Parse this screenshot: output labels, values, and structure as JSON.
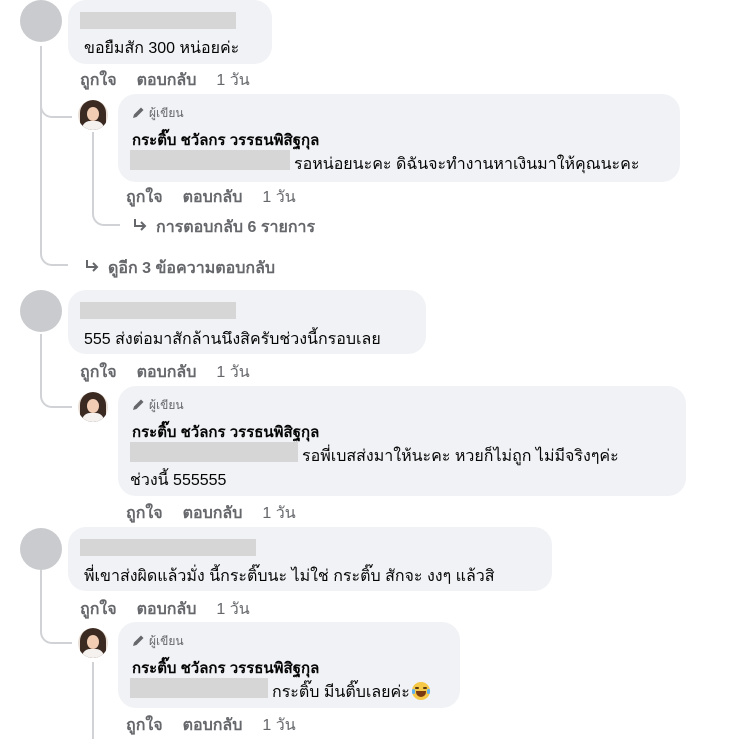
{
  "threads": [
    {
      "comment": {
        "text": "ขอยืมสัก 300 หน่อยค่ะ"
      },
      "actions": {
        "like": "ถูกใจ",
        "reply": "ตอบกลับ",
        "time": "1 วัน"
      },
      "reply": {
        "badge": "ผู้เขียน",
        "author": "กระติ๊บ ชวัลกร วรรธนพิสิฐกุล",
        "text": "รอหน่อยนะคะ ดิฉันจะทำงานหาเงินมาให้คุณนะคะ",
        "actions": {
          "like": "ถูกใจ",
          "reply": "ตอบกลับ",
          "time": "1 วัน"
        },
        "more_replies": "การตอบกลับ 6 รายการ"
      },
      "view_more": "ดูอีก 3 ข้อความตอบกลับ"
    },
    {
      "comment": {
        "text": "555 ส่งต่อมาสักล้านนึงสิครับช่วงนี้กรอบเลย"
      },
      "actions": {
        "like": "ถูกใจ",
        "reply": "ตอบกลับ",
        "time": "1 วัน"
      },
      "reply": {
        "badge": "ผู้เขียน",
        "author": "กระติ๊บ ชวัลกร วรรธนพิสิฐกุล",
        "text_line1": "รอพี่เบสส่งมาให้นะคะ หวยก็ไม่ถูก ไม่มีจริงๆค่ะ",
        "text_line2": "ช่วงนี้ 555555",
        "actions": {
          "like": "ถูกใจ",
          "reply": "ตอบกลับ",
          "time": "1 วัน"
        }
      }
    },
    {
      "comment": {
        "text": "พี่เขาส่งผิดแล้วมั่ง นี้กระติ๊บนะ ไม่ใช่ กระติ๊บ สักจะ งงๆ แล้วสิ"
      },
      "actions": {
        "like": "ถูกใจ",
        "reply": "ตอบกลับ",
        "time": "1 วัน"
      },
      "reply": {
        "badge": "ผู้เขียน",
        "author": "กระติ๊บ ชวัลกร วรรธนพิสิฐกุล",
        "text": "กระติ๊บ มีนติ๊บเลยค่ะ",
        "emoji": "tears-of-joy-emoji",
        "actions": {
          "like": "ถูกใจ",
          "reply": "ตอบกลับ",
          "time": "1 วัน"
        }
      }
    }
  ]
}
